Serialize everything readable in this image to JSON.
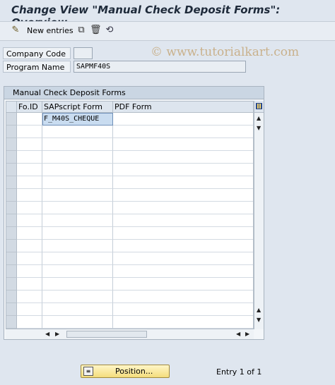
{
  "window": {
    "title": "Change View \"Manual Check Deposit Forms\": Overview"
  },
  "toolbar": {
    "new_entries_label": "New entries",
    "icons": [
      "pencil-glasses-icon",
      "copy-icon",
      "delete-icon",
      "undo-icon"
    ]
  },
  "watermark": "© www.tutorialkart.com",
  "fields": {
    "company_code": {
      "label": "Company Code",
      "value": ""
    },
    "program_name": {
      "label": "Program Name",
      "value": "SAPMF40S"
    }
  },
  "table": {
    "title": "Manual Check Deposit Forms",
    "columns": [
      "Fo.ID",
      "SAPscript Form",
      "PDF Form"
    ],
    "rows": [
      {
        "fo_id": "",
        "sapscript_form": "F_M40S_CHEQUE",
        "pdf_form": ""
      }
    ]
  },
  "footer": {
    "position_label": "Position...",
    "entry_text": "Entry 1 of 1"
  }
}
